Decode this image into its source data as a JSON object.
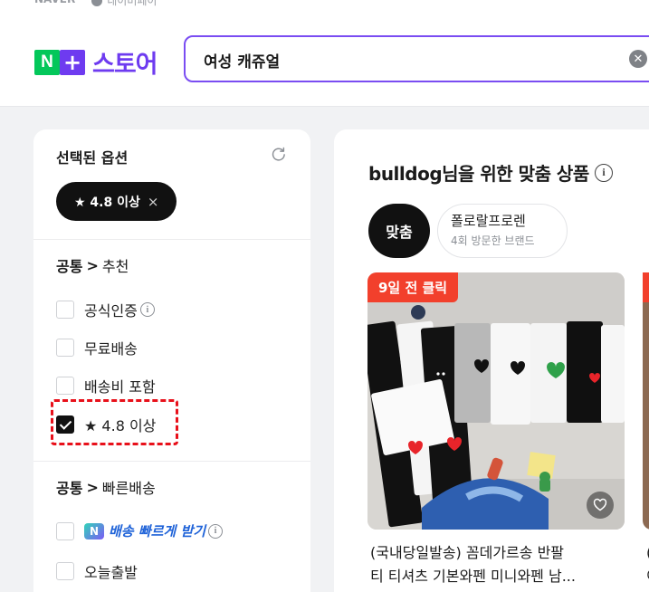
{
  "header": {
    "naver_label": "NAVER",
    "pay_label": "네이버페이",
    "logo_n": "N",
    "logo_plus": "+",
    "logo_text": "스토어",
    "search_value": "여성 캐쥬얼",
    "clear_icon": "clear-icon"
  },
  "filters": {
    "selected_title": "선택된 옵션",
    "refresh_icon": "refresh-icon",
    "chip_label": "★ 4.8 이상",
    "chip_close": "×",
    "section1": {
      "head": "공통",
      "arrow": ">",
      "sub": "추천",
      "items": [
        {
          "label": "공식인증",
          "checked": false,
          "info": true
        },
        {
          "label": "무료배송",
          "checked": false
        },
        {
          "label": "배송비 포함",
          "checked": false
        },
        {
          "label": "★ 4.8 이상",
          "checked": true
        }
      ]
    },
    "section2": {
      "head": "공통",
      "arrow": ">",
      "sub": "빠른배송",
      "items": [
        {
          "label": "배송 빠르게 받기",
          "badge_n": "N",
          "checked": false,
          "info": true
        },
        {
          "label": "오늘출발",
          "checked": false
        }
      ]
    },
    "highlight_color": "#e8101a"
  },
  "recommend": {
    "title": "bulldog님을 위한 맞춤 상품",
    "pill_active": "맞춤",
    "pill_brand": "폴로랄프로렌",
    "pill_brand_sub": "4회 방문한 브랜드",
    "product": {
      "badge": "9일 전 클릭",
      "name_line1": "(국내당일발송) 꼼데가르송 반팔",
      "name_line2": "티 티셔츠 기본와펜 미니와펜 남...",
      "heart_icon": "heart-icon"
    },
    "next_product_name": "(",
    "next_product_name2": "이"
  },
  "colors": {
    "brand_green": "#03c75a",
    "brand_purple": "#6e3bf0",
    "badge_red": "#f2402c"
  }
}
